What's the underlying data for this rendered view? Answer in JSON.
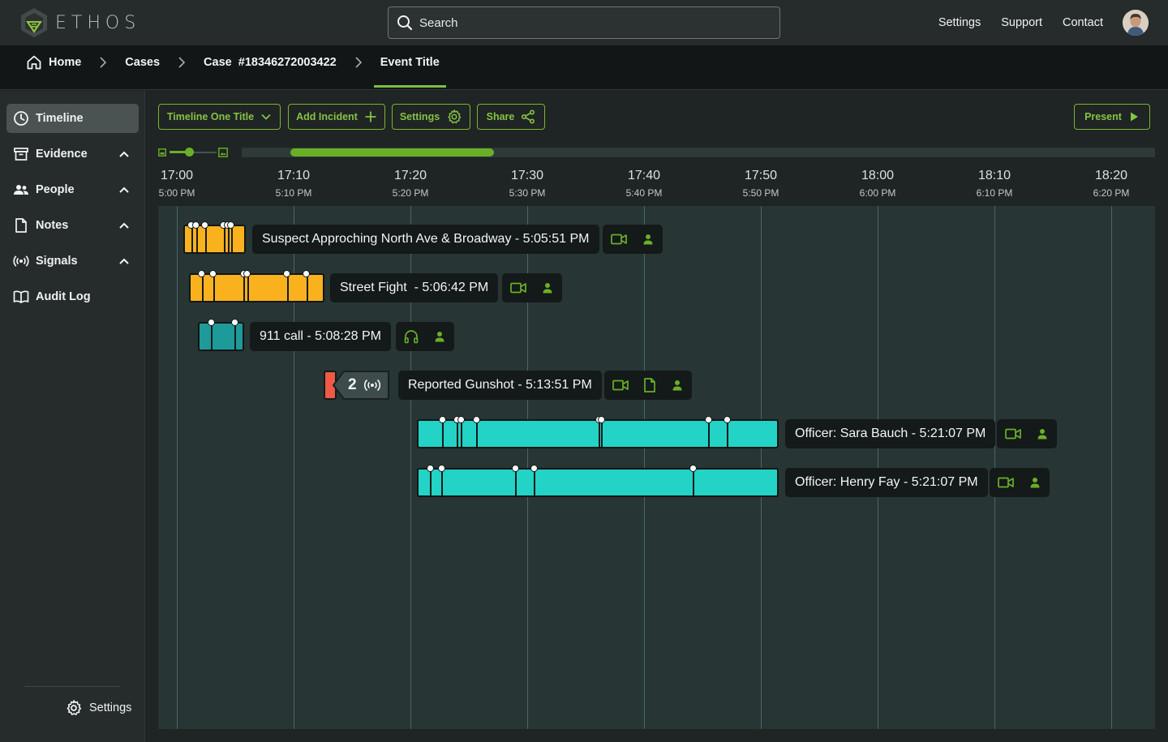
{
  "app": {
    "logo_text": "ETHOS"
  },
  "search": {
    "placeholder": "Search"
  },
  "top_nav": {
    "settings": "Settings",
    "support": "Support",
    "contact": "Contact"
  },
  "breadcrumb": {
    "home": "Home",
    "cases": "Cases",
    "case": "Case  #18346272003422",
    "event": "Event Title"
  },
  "sidebar": {
    "items": [
      {
        "label": "Timeline",
        "icon": "clock-icon",
        "active": true
      },
      {
        "label": "Evidence",
        "icon": "archive-box-icon",
        "expandable": true
      },
      {
        "label": "People",
        "icon": "people-icon",
        "expandable": true
      },
      {
        "label": "Notes",
        "icon": "document-icon",
        "expandable": true
      },
      {
        "label": "Signals",
        "icon": "broadcast-icon",
        "expandable": true
      },
      {
        "label": "Audit Log",
        "icon": "book-icon"
      }
    ],
    "settings": "Settings"
  },
  "toolbar": {
    "timeline_title": "Timeline One Title",
    "add_incident": "Add Incident",
    "settings": "Settings",
    "share": "Share",
    "present": "Present"
  },
  "overview": {
    "window_start": 0.0537,
    "window_end": 0.2762
  },
  "timeline": {
    "ticks": [
      {
        "time24": "17:00",
        "time12": "5:00 PM"
      },
      {
        "time24": "17:10",
        "time12": "5:10 PM"
      },
      {
        "time24": "17:20",
        "time12": "5:20 PM"
      },
      {
        "time24": "17:30",
        "time12": "5:30 PM"
      },
      {
        "time24": "17:40",
        "time12": "5:40 PM"
      },
      {
        "time24": "17:50",
        "time12": "5:50 PM"
      },
      {
        "time24": "18:00",
        "time12": "6:00 PM"
      },
      {
        "time24": "18:10",
        "time12": "6:10 PM"
      },
      {
        "time24": "18:20",
        "time12": "6:20 PM"
      }
    ],
    "events": [
      {
        "label": "Suspect Approching North Ave & Broadway - 5:05:51 PM",
        "color": "#f9b21d",
        "icons": [
          "video-camera-icon",
          "person-icon"
        ]
      },
      {
        "label": "Street Fight  - 5:06:42 PM",
        "color": "#f9b21d",
        "icons": [
          "video-camera-icon",
          "person-icon"
        ]
      },
      {
        "label": "911 call - 5:08:28 PM",
        "color": "#1f9a9a",
        "icons": [
          "headphones-icon",
          "person-icon"
        ]
      },
      {
        "label": "Reported Gunshot - 5:13:51 PM",
        "signal_count": "2",
        "signal_color": "#ee5a45",
        "icons": [
          "video-camera-icon",
          "document-icon",
          "person-icon"
        ]
      },
      {
        "label": "Officer: Sara Bauch - 5:21:07 PM",
        "color": "#22d3c6",
        "icons": [
          "video-camera-icon",
          "person-icon"
        ]
      },
      {
        "label": "Officer: Henry Fay - 5:21:07 PM",
        "color": "#22d3c6",
        "icons": [
          "video-camera-icon",
          "person-icon"
        ]
      }
    ]
  },
  "colors": {
    "accent": "#7bc043",
    "amber": "#f9b21d",
    "teal_dark": "#1f9a9a",
    "teal": "#22d3c6",
    "alert": "#ee5a45"
  }
}
